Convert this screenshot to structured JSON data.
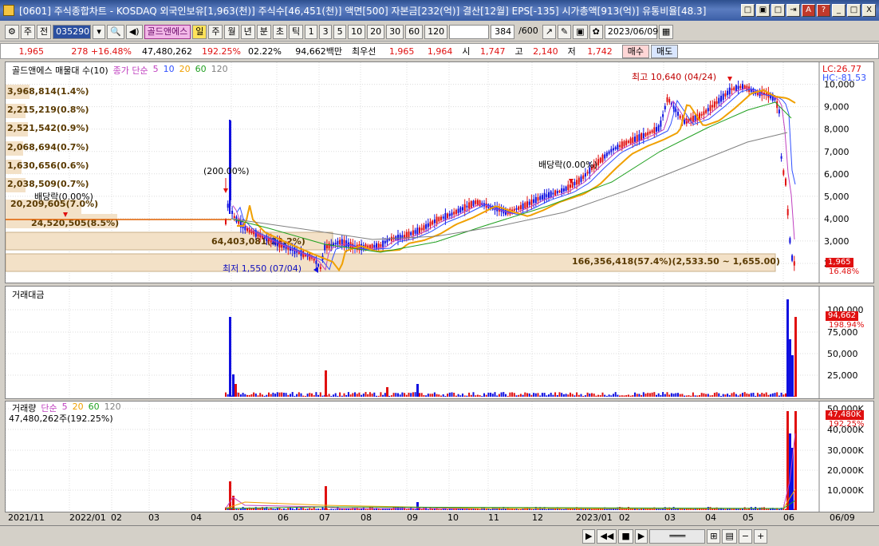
{
  "window": {
    "title": "[0601] 주식종합차트 - KOSDAQ 외국인보유[1,963(천)] 주식수[46,451(천)] 액면[500] 자본금[232(억)] 결산[12월] EPS[-135] 시가총액[913(억)] 유통비율[48.3]",
    "buttons": [
      "□",
      "▣",
      "□",
      "⇥",
      "A",
      "?",
      "_",
      "□",
      "X"
    ]
  },
  "toolbar": {
    "market": "주",
    "range": "전",
    "code": "035290",
    "stock_name": "골드앤에스",
    "periods": [
      "일",
      "주",
      "월",
      "년",
      "분",
      "초",
      "틱"
    ],
    "intervals": [
      "1",
      "3",
      "5",
      "10",
      "20",
      "30",
      "60",
      "120"
    ],
    "count": "384",
    "count_total": "/600",
    "date": "2023/06/09"
  },
  "quote": {
    "price": "1,965",
    "change": "278 +16.48%",
    "volume": "47,480,262",
    "volume_ratio": "192.25%",
    "turnover": "02.22%",
    "amount": "94,662백만",
    "best_label": "최우선",
    "ask": "1,965",
    "bid": "1,964",
    "open_label": "시",
    "open": "1,747",
    "high_label": "고",
    "high": "2,140",
    "low_label": "저",
    "low": "1,742",
    "buy_label": "매수",
    "sell_label": "매도"
  },
  "price_panel": {
    "legend_name": "골드앤에스 매물대 수(10)",
    "legend_ma": "종가 단순",
    "legend_periods": [
      "5",
      "10",
      "20",
      "60",
      "120"
    ],
    "lc": "LC:26.77",
    "hc": "HC:-81.53",
    "high_note": "최고 10,640 (04/24)",
    "low_note": "최저 1,550 (07/04)",
    "div_note1": "배당락(0.00%)",
    "div_note2": "배당락(0.00%)",
    "split_note": "(200.00%)",
    "profile_labels": [
      "3,968,814(1.4%)",
      "2,215,219(0.8%)",
      "2,521,542(0.9%)",
      "2,068,694(0.7%)",
      "1,630,656(0.6%)",
      "2,038,509(0.7%)",
      "20,209,605(7.0%)",
      "24,520,505(8.5%)",
      "64,403,081(22.2%)"
    ],
    "profile_big": "166,356,418(57.4%)(2,533.50 ~ 1,655.00)",
    "yticks": [
      "10,000",
      "9,000",
      "8,000",
      "7,000",
      "6,000",
      "5,000",
      "4,000",
      "3,000",
      "2,000"
    ],
    "last_price": "1,965",
    "last_pct": "16.48%"
  },
  "amount_panel": {
    "title": "거래대금",
    "yticks": [
      "100,000",
      "75,000",
      "50,000",
      "25,000"
    ],
    "last": "94,662",
    "last_pct": "198.94%"
  },
  "volume_panel": {
    "title": "거래량",
    "ma_label": "단순",
    "ma_periods": [
      "5",
      "20",
      "60",
      "120"
    ],
    "value": "47,480,262주(192.25%)",
    "yticks": [
      "50,000K",
      "40,000K",
      "30,000K",
      "20,000K",
      "10,000K"
    ],
    "last": "47,480K",
    "last_pct": "192.25%"
  },
  "xaxis": [
    "2021/11",
    "2022/01",
    "02",
    "03",
    "04",
    "05",
    "06",
    "07",
    "08",
    "09",
    "10",
    "11",
    "12",
    "2023/01",
    "02",
    "03",
    "04",
    "05",
    "06",
    "06/09"
  ],
  "chart_data": {
    "type": "candlestick",
    "price_series_approx": {
      "dates": [
        "2022-04",
        "2022-05",
        "2022-06",
        "2022-07",
        "2022-08",
        "2022-09",
        "2022-10",
        "2022-11",
        "2022-12",
        "2023-01",
        "2023-02",
        "2023-03",
        "2023-04",
        "2023-05",
        "2023-06-09"
      ],
      "close": [
        3950,
        3500,
        2200,
        1600,
        2300,
        2600,
        3100,
        4500,
        3600,
        4700,
        6500,
        8300,
        10200,
        9900,
        1965
      ]
    },
    "ylim": [
      1500,
      10700
    ],
    "high": 10640,
    "low": 1550
  },
  "colors": {
    "up": "#e01010",
    "down": "#1010e0",
    "ma5": "#c040c0",
    "ma10": "#3050ff",
    "ma20": "#f0a000",
    "ma60": "#20a020",
    "ma120": "#808080"
  }
}
